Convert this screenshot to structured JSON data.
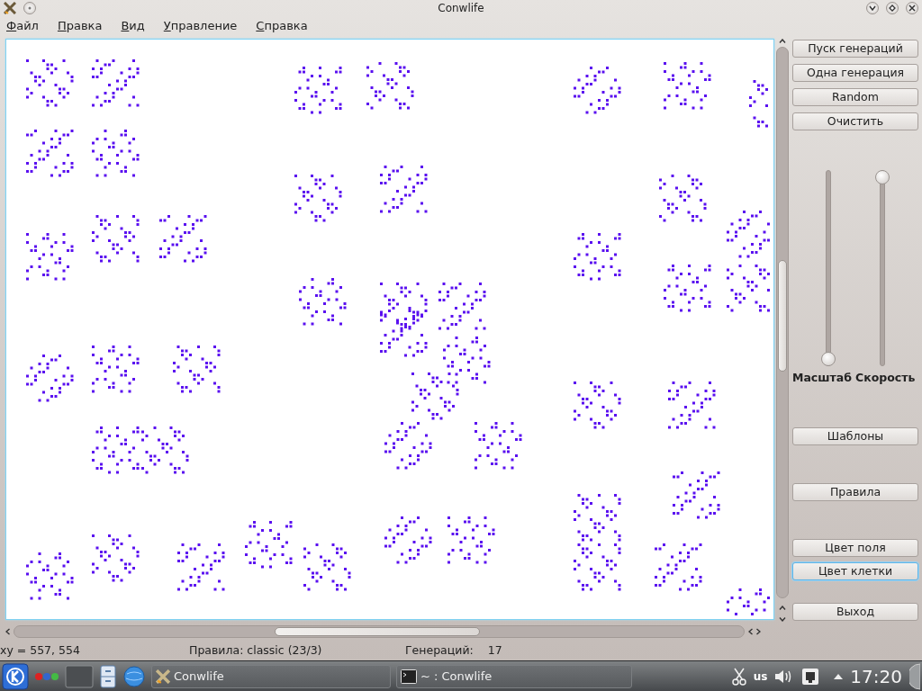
{
  "window": {
    "title": "Conwlife"
  },
  "menu": [
    {
      "label": "Файл"
    },
    {
      "label": "Правка"
    },
    {
      "label": "Вид"
    },
    {
      "label": "Управление"
    },
    {
      "label": "Справка"
    }
  ],
  "buttons_top": [
    {
      "label": "Пуск генераций",
      "focused": false
    },
    {
      "label": "Одна генерация",
      "focused": false
    },
    {
      "label": "Random",
      "focused": false
    },
    {
      "label": "Очистить",
      "focused": false
    }
  ],
  "sliders": [
    {
      "label": "Масштаб",
      "level": 0
    },
    {
      "label": "Скорость",
      "level": 1
    }
  ],
  "buttons_bottom": [
    {
      "label": "Шаблоны",
      "focused": false
    },
    {
      "label": "Правила",
      "focused": false
    },
    {
      "label": "Цвет поля",
      "focused": false
    },
    {
      "label": "Цвет клетки",
      "focused": true
    },
    {
      "label": "Выход",
      "focused": false
    }
  ],
  "status_bar": {
    "cursor": "xy = 557, 554",
    "rules": "Правила: classic (23/3)",
    "generations_label": "Генераций:",
    "generations": "17"
  },
  "taskbar": {
    "tasks": [
      {
        "label": "Conwlife"
      },
      {
        "label": "~ : Conwlife"
      }
    ],
    "keyboard_layout": "us",
    "clock": "17:20"
  }
}
